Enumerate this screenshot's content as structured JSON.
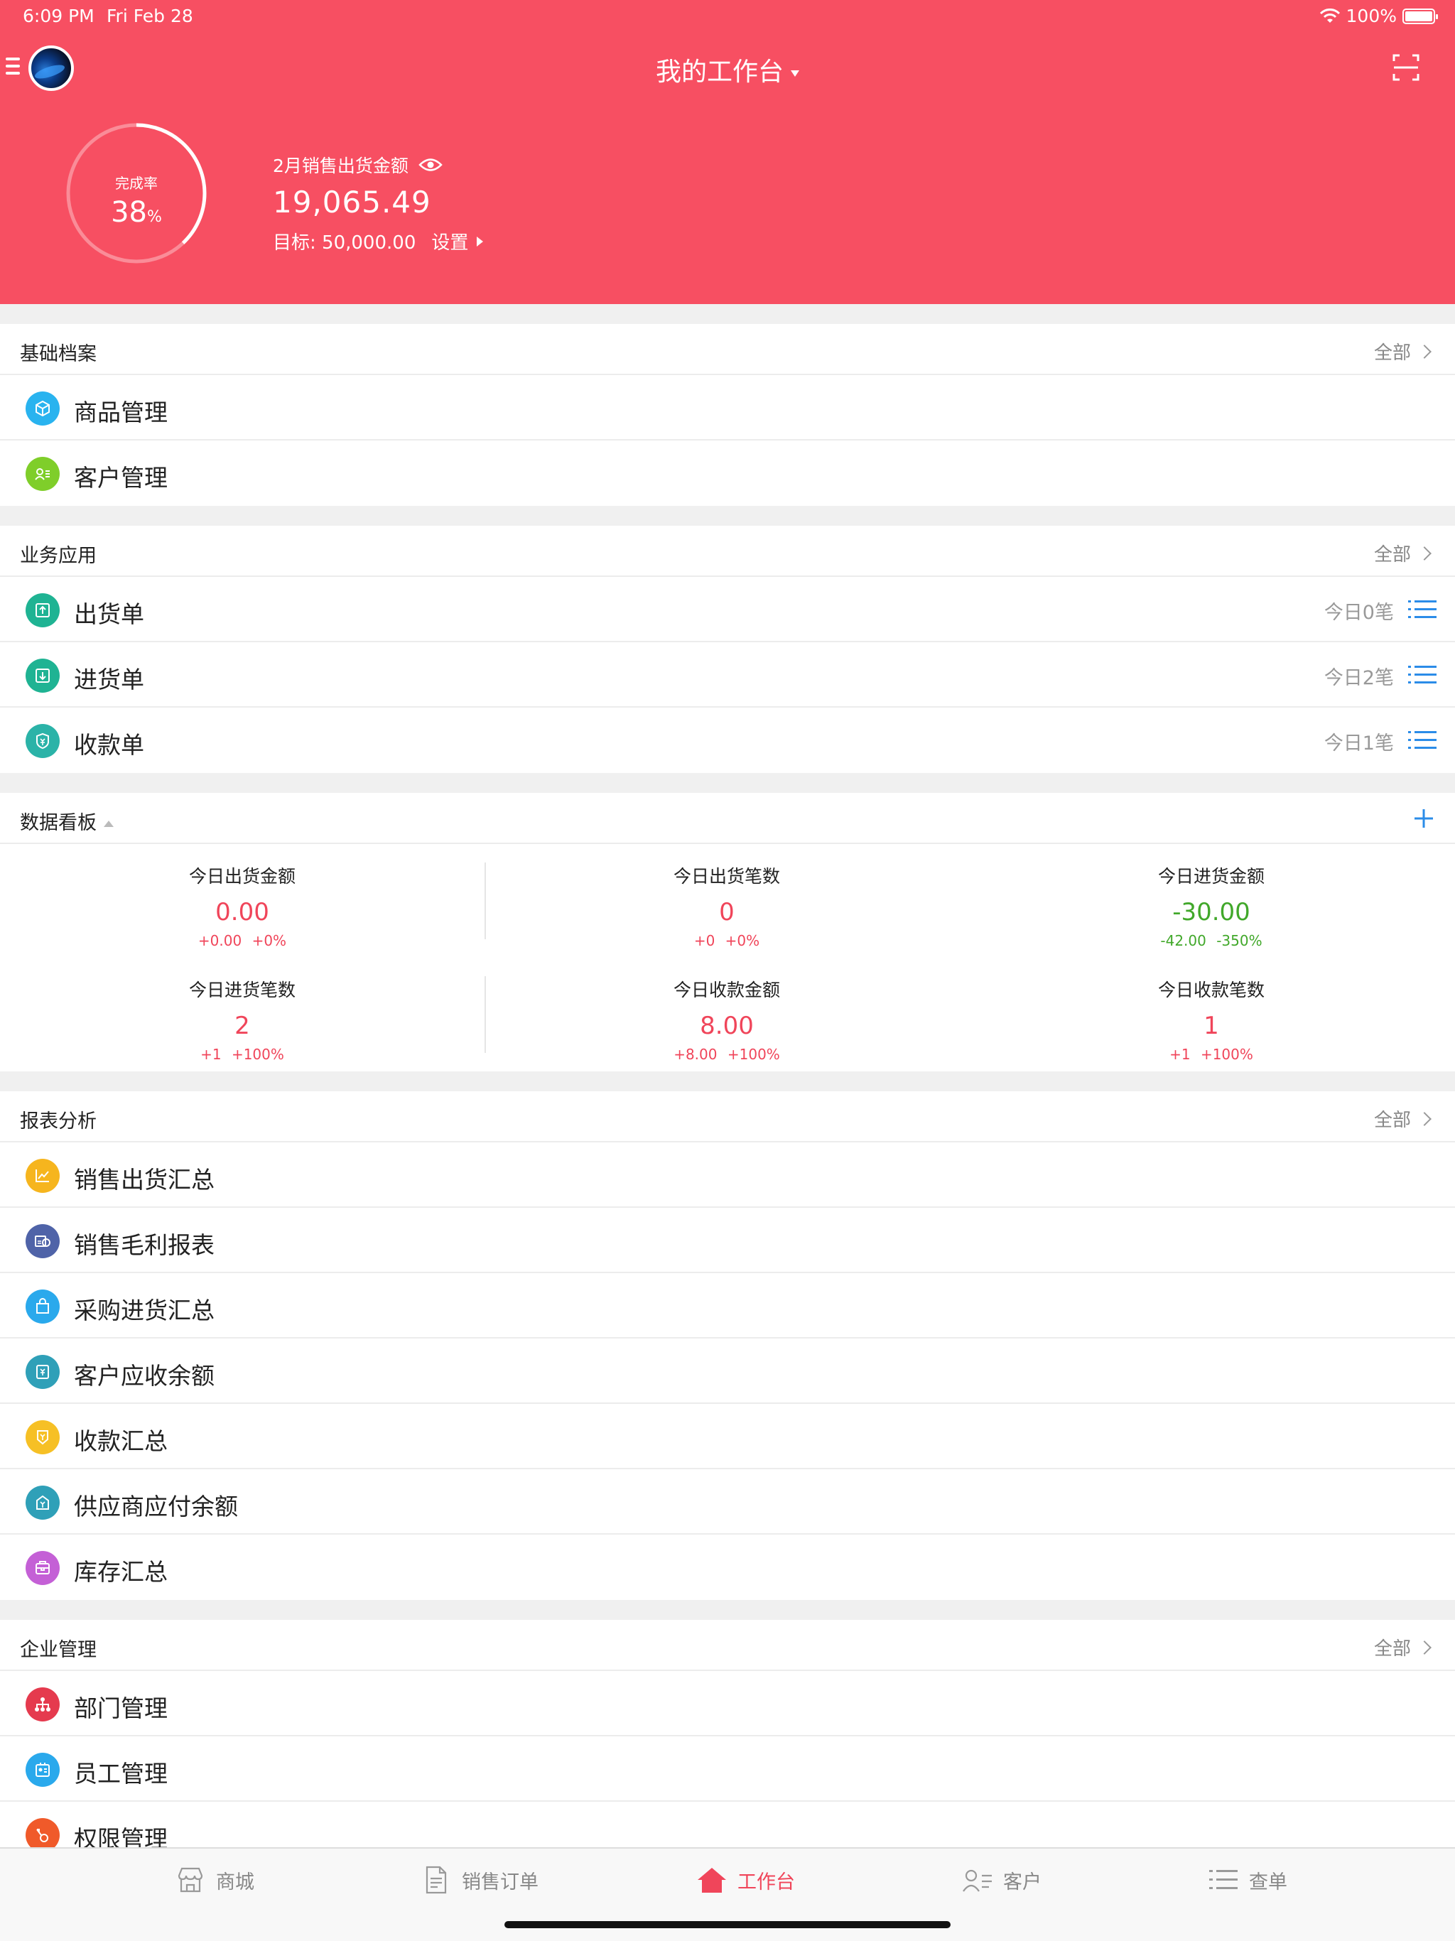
{
  "status_bar": {
    "time": "6:09 PM",
    "date": "Fri Feb 28",
    "battery": "100%",
    "battery_level": 1.0
  },
  "header": {
    "title": "我的工作台",
    "completion_label": "完成率",
    "completion_value": "38",
    "completion_unit": "%",
    "completion_fraction": 0.38,
    "sales_label": "2月销售出货金额",
    "sales_amount": "19,065.49",
    "target_label": "目标:",
    "target_value": "50,000.00",
    "settings_label": "设置",
    "accent_color": "#f74f62"
  },
  "basic": {
    "title": "基础档案",
    "all": "全部",
    "items": [
      {
        "label": "商品管理",
        "icon": "cube-icon",
        "color": "#29b3ef"
      },
      {
        "label": "客户管理",
        "icon": "customer-card-icon",
        "color": "#7fce2a"
      }
    ]
  },
  "business": {
    "title": "业务应用",
    "all": "全部",
    "items": [
      {
        "label": "出货单",
        "today": "今日0笔",
        "icon": "outbound-icon",
        "color": "#1fb393"
      },
      {
        "label": "进货单",
        "today": "今日2笔",
        "icon": "inbound-icon",
        "color": "#1fb393"
      },
      {
        "label": "收款单",
        "today": "今日1笔",
        "icon": "receipt-icon",
        "color": "#2bb3a8"
      }
    ]
  },
  "dashboard": {
    "title": "数据看板",
    "cells": [
      {
        "label": "今日出货金额",
        "value": "0.00",
        "delta": "+0.00",
        "pct": "+0%",
        "tone": "red"
      },
      {
        "label": "今日出货笔数",
        "value": "0",
        "delta": "+0",
        "pct": "+0%",
        "tone": "red"
      },
      {
        "label": "今日进货金额",
        "value": "-30.00",
        "delta": "-42.00",
        "pct": "-350%",
        "tone": "green"
      },
      {
        "label": "今日进货笔数",
        "value": "2",
        "delta": "+1",
        "pct": "+100%",
        "tone": "red"
      },
      {
        "label": "今日收款金额",
        "value": "8.00",
        "delta": "+8.00",
        "pct": "+100%",
        "tone": "red"
      },
      {
        "label": "今日收款笔数",
        "value": "1",
        "delta": "+1",
        "pct": "+100%",
        "tone": "red"
      }
    ]
  },
  "reports": {
    "title": "报表分析",
    "all": "全部",
    "items": [
      {
        "label": "销售出货汇总",
        "icon": "trend-chart-icon",
        "color": "#f6b51e"
      },
      {
        "label": "销售毛利报表",
        "icon": "profit-report-icon",
        "color": "#4f63a8"
      },
      {
        "label": "采购进货汇总",
        "icon": "shopping-bag-icon",
        "color": "#2aa9ec"
      },
      {
        "label": "客户应收余额",
        "icon": "receivable-icon",
        "color": "#2fa0b8"
      },
      {
        "label": "收款汇总",
        "icon": "collection-icon",
        "color": "#f6c025"
      },
      {
        "label": "供应商应付余额",
        "icon": "payable-icon",
        "color": "#2fa0b8"
      },
      {
        "label": "库存汇总",
        "icon": "inventory-icon",
        "color": "#c460d6"
      }
    ]
  },
  "enterprise": {
    "title": "企业管理",
    "all": "全部",
    "items": [
      {
        "label": "部门管理",
        "icon": "org-chart-icon",
        "color": "#e53a4e"
      },
      {
        "label": "员工管理",
        "icon": "employee-badge-icon",
        "color": "#2aa9ec"
      },
      {
        "label": "权限管理",
        "icon": "key-icon",
        "color": "#f05a2a"
      }
    ]
  },
  "tabbar": {
    "items": [
      {
        "label": "商城",
        "icon": "store-icon"
      },
      {
        "label": "销售订单",
        "icon": "document-icon"
      },
      {
        "label": "工作台",
        "icon": "home-icon",
        "active": true
      },
      {
        "label": "客户",
        "icon": "contacts-icon"
      },
      {
        "label": "查单",
        "icon": "list-icon"
      }
    ]
  }
}
